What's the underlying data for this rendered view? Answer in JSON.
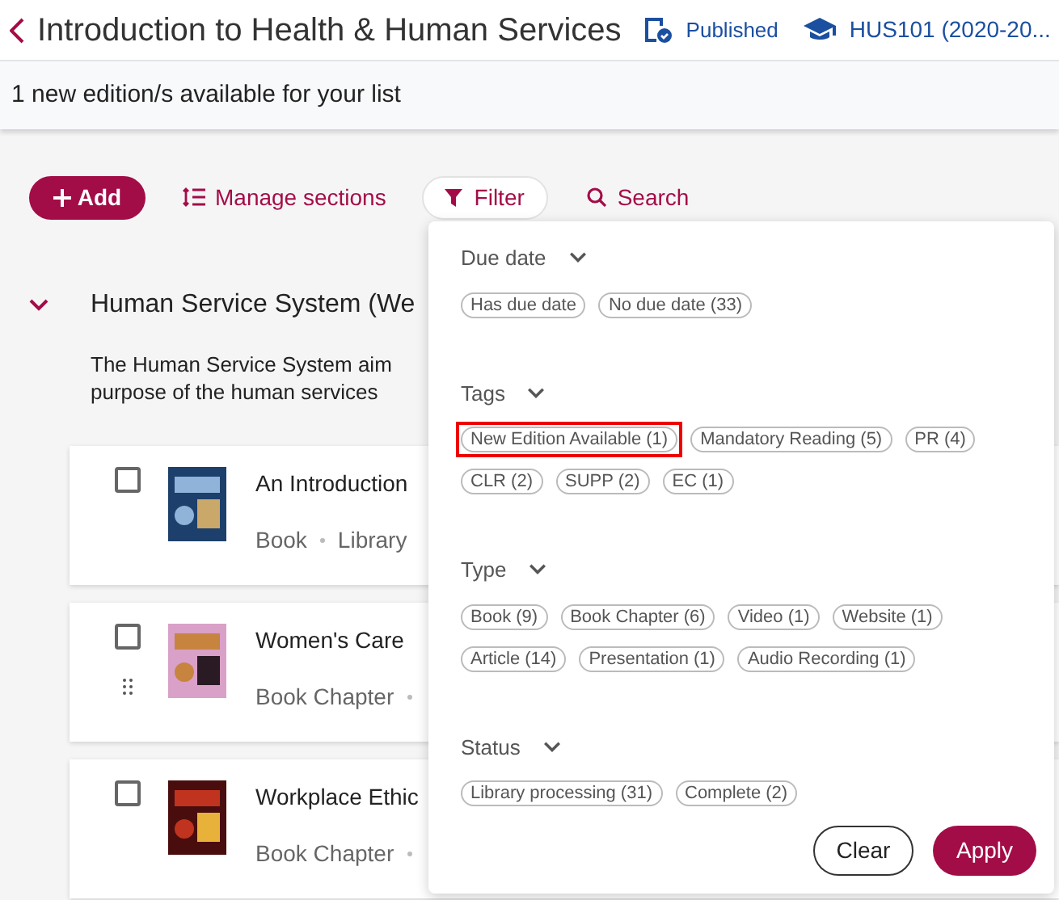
{
  "header": {
    "title": "Introduction to Health & Human Services",
    "status": "Published",
    "course": "HUS101 (2020-20..."
  },
  "banner": {
    "text": "1 new edition/s available for your list"
  },
  "toolbar": {
    "add": "Add",
    "manage": "Manage sections",
    "filter": "Filter",
    "search": "Search"
  },
  "section": {
    "title": "Human Service System (We",
    "expanded": true,
    "description_lines": [
      "The Human Service System aim",
      "purpose of the human services"
    ]
  },
  "items": [
    {
      "title": "An Introduction",
      "meta": [
        "Book",
        "Library"
      ],
      "checked": false,
      "drag_handle": false
    },
    {
      "title": "Women's Care",
      "meta": [
        "Book Chapter"
      ],
      "checked": false,
      "drag_handle": true
    },
    {
      "title": "Workplace Ethic",
      "meta": [
        "Book Chapter"
      ],
      "checked": false,
      "drag_handle": false
    }
  ],
  "filter_panel": {
    "groups": [
      {
        "title": "Due date",
        "chips": [
          {
            "label": "Has due date",
            "highlighted": false
          },
          {
            "label": "No due date (33)",
            "highlighted": false
          }
        ]
      },
      {
        "title": "Tags",
        "chips": [
          {
            "label": "New Edition Available (1)",
            "highlighted": true
          },
          {
            "label": "Mandatory Reading (5)",
            "highlighted": false
          },
          {
            "label": "PR (4)",
            "highlighted": false
          },
          {
            "label": "CLR (2)",
            "highlighted": false
          },
          {
            "label": "SUPP (2)",
            "highlighted": false
          },
          {
            "label": "EC (1)",
            "highlighted": false
          }
        ]
      },
      {
        "title": "Type",
        "chips": [
          {
            "label": "Book (9)",
            "highlighted": false
          },
          {
            "label": "Book Chapter (6)",
            "highlighted": false
          },
          {
            "label": "Video (1)",
            "highlighted": false
          },
          {
            "label": "Website (1)",
            "highlighted": false
          },
          {
            "label": "Article (14)",
            "highlighted": false
          },
          {
            "label": "Presentation (1)",
            "highlighted": false
          },
          {
            "label": "Audio Recording (1)",
            "highlighted": false
          }
        ]
      },
      {
        "title": "Status",
        "chips": [
          {
            "label": "Library processing (31)",
            "highlighted": false
          },
          {
            "label": "Complete (2)",
            "highlighted": false
          }
        ]
      }
    ],
    "clear": "Clear",
    "apply": "Apply"
  }
}
